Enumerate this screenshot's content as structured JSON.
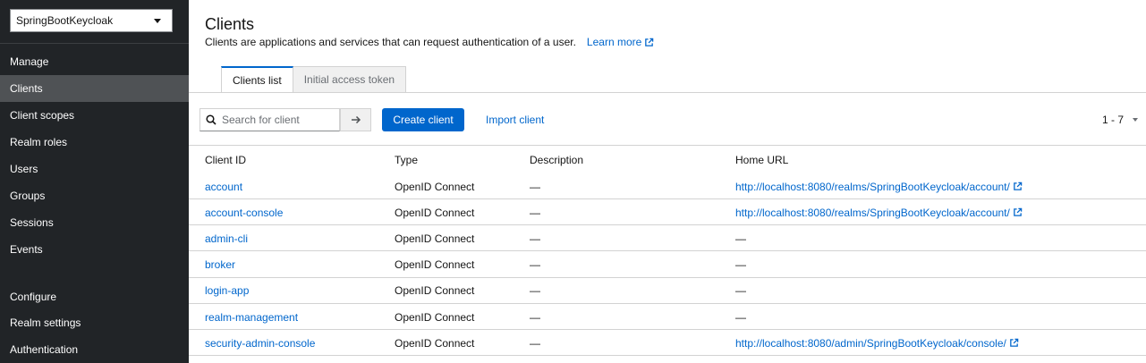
{
  "sidebar": {
    "realm": "SpringBootKeycloak",
    "groups": [
      {
        "title": "Manage",
        "items": [
          "Clients",
          "Client scopes",
          "Realm roles",
          "Users",
          "Groups",
          "Sessions",
          "Events"
        ]
      },
      {
        "title": "Configure",
        "items": [
          "Realm settings",
          "Authentication"
        ]
      }
    ],
    "active_item": "Clients"
  },
  "page": {
    "title": "Clients",
    "description": "Clients are applications and services that can request authentication of a user.",
    "learn_more": "Learn more"
  },
  "tabs": [
    {
      "label": "Clients list",
      "active": true
    },
    {
      "label": "Initial access token",
      "active": false
    }
  ],
  "toolbar": {
    "search_placeholder": "Search for client",
    "create_label": "Create client",
    "import_label": "Import client",
    "pagination": "1 - 7"
  },
  "table": {
    "headers": [
      "Client ID",
      "Type",
      "Description",
      "Home URL"
    ],
    "rows": [
      {
        "client_id": "account",
        "type": "OpenID Connect",
        "description": "—",
        "home_url": "http://localhost:8080/realms/SpringBootKeycloak/account/",
        "has_link": true
      },
      {
        "client_id": "account-console",
        "type": "OpenID Connect",
        "description": "—",
        "home_url": "http://localhost:8080/realms/SpringBootKeycloak/account/",
        "has_link": true
      },
      {
        "client_id": "admin-cli",
        "type": "OpenID Connect",
        "description": "—",
        "home_url": "—",
        "has_link": false
      },
      {
        "client_id": "broker",
        "type": "OpenID Connect",
        "description": "—",
        "home_url": "—",
        "has_link": false
      },
      {
        "client_id": "login-app",
        "type": "OpenID Connect",
        "description": "—",
        "home_url": "—",
        "has_link": false
      },
      {
        "client_id": "realm-management",
        "type": "OpenID Connect",
        "description": "—",
        "home_url": "—",
        "has_link": false
      },
      {
        "client_id": "security-admin-console",
        "type": "OpenID Connect",
        "description": "—",
        "home_url": "http://localhost:8080/admin/SpringBootKeycloak/console/",
        "has_link": true
      }
    ]
  },
  "colors": {
    "accent": "#0066cc",
    "sidebar_bg": "#212427",
    "sidebar_active": "#4f5255"
  }
}
